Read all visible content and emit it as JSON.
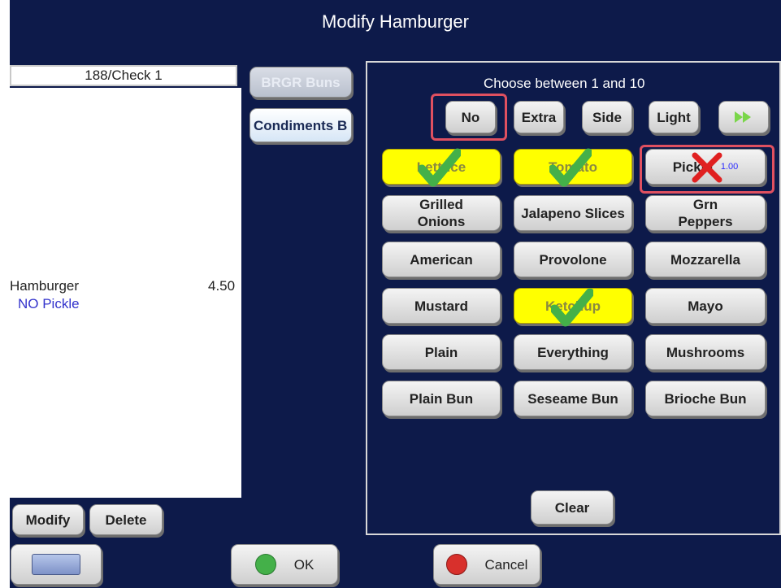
{
  "dialog": {
    "title": "Modify Hamburger"
  },
  "check": {
    "header": "188/Check 1",
    "items": [
      {
        "name": "Hamburger",
        "price": "4.50",
        "modifier": "NO Pickle"
      }
    ]
  },
  "categories": {
    "brgr_buns": "BRGR Buns",
    "condiments": "Condiments B"
  },
  "choose_text": "Choose between 1 and 10",
  "modifier_bar": {
    "no": "No",
    "extra": "Extra",
    "side": "Side",
    "light": "Light",
    "next_icon": "double-arrow-right-icon"
  },
  "grid": {
    "lettuce": "Lettuce",
    "tomato": "Tomato",
    "pickle": "Pickle",
    "pickle_price": "1.00",
    "grilled_onions": "Grilled\nOnions",
    "jalapeno": "Jalapeno Slices",
    "grn_peppers": "Grn\nPeppers",
    "american": "American",
    "provolone": "Provolone",
    "mozzarella": "Mozzarella",
    "mustard": "Mustard",
    "ketchup": "Ketchup",
    "mayo": "Mayo",
    "plain": "Plain",
    "everything": "Everything",
    "mushrooms": "Mushrooms",
    "plain_bun": "Plain Bun",
    "sesame_bun": "Seseame Bun",
    "brioche_bun": "Brioche Bun"
  },
  "actions": {
    "clear": "Clear",
    "modify": "Modify",
    "delete": "Delete",
    "ok": "OK",
    "cancel": "Cancel"
  },
  "colors": {
    "background": "#0d1a4a",
    "selected": "#ffff00",
    "highlight": "#e05060",
    "check": "#44b049",
    "x": "#e02020"
  }
}
